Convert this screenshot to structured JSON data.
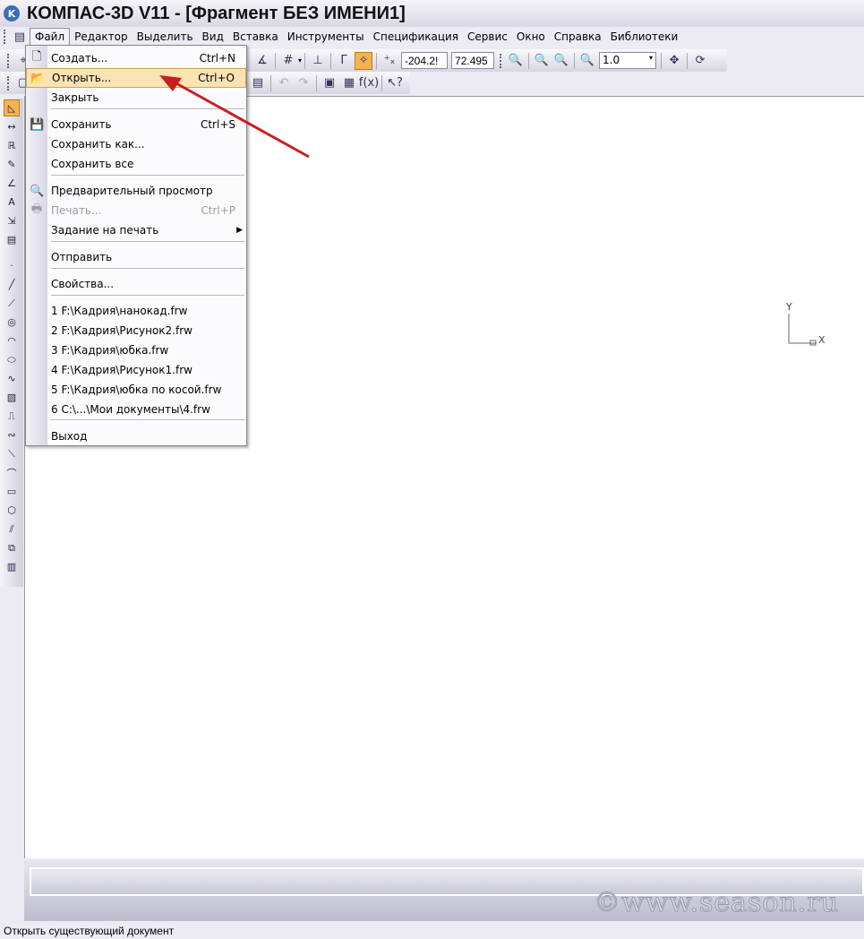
{
  "window": {
    "title": "КОМПАС-3D V11 - [Фрагмент БЕЗ ИМЕНИ1]"
  },
  "menubar": [
    "Файл",
    "Редактор",
    "Выделить",
    "Вид",
    "Вставка",
    "Инструменты",
    "Спецификация",
    "Сервис",
    "Окно",
    "Справка",
    "Библиотеки"
  ],
  "toolbar": {
    "coord_x": "-204.2!",
    "coord_y": "72.495",
    "zoom": "1.0",
    "fx_label": "f(x)"
  },
  "file_menu": [
    {
      "label": "Создать...",
      "shortcut": "Ctrl+N",
      "icon": "new-document-icon"
    },
    {
      "label": "Открыть...",
      "shortcut": "Ctrl+O",
      "icon": "open-folder-icon",
      "highlighted": true
    },
    {
      "label": "Закрыть"
    },
    {
      "label": "Сохранить",
      "shortcut": "Ctrl+S",
      "icon": "save-icon"
    },
    {
      "label": "Сохранить как..."
    },
    {
      "label": "Сохранить все"
    },
    {
      "label": "Предварительный просмотр",
      "icon": "print-preview-icon"
    },
    {
      "label": "Печать...",
      "shortcut": "Ctrl+P",
      "icon": "print-icon",
      "disabled": true
    },
    {
      "label": "Задание на печать",
      "submenu": true
    },
    {
      "label": "Отправить"
    },
    {
      "label": "Свойства..."
    },
    {
      "label": "1 F:\\Кадрия\\нанокад.frw"
    },
    {
      "label": "2 F:\\Кадрия\\Рисунок2.frw"
    },
    {
      "label": "3 F:\\Кадрия\\юбка.frw"
    },
    {
      "label": "4 F:\\Кадрия\\Рисунок1.frw"
    },
    {
      "label": "5 F:\\Кадрия\\юбка по косой.frw"
    },
    {
      "label": "6 C:\\...\\Мои документы\\4.frw"
    },
    {
      "label": "Выход"
    }
  ],
  "canvas": {
    "axis_x": "X",
    "axis_y": "Y"
  },
  "watermark": "©www.season.ru",
  "status": "Открыть существующий документ"
}
